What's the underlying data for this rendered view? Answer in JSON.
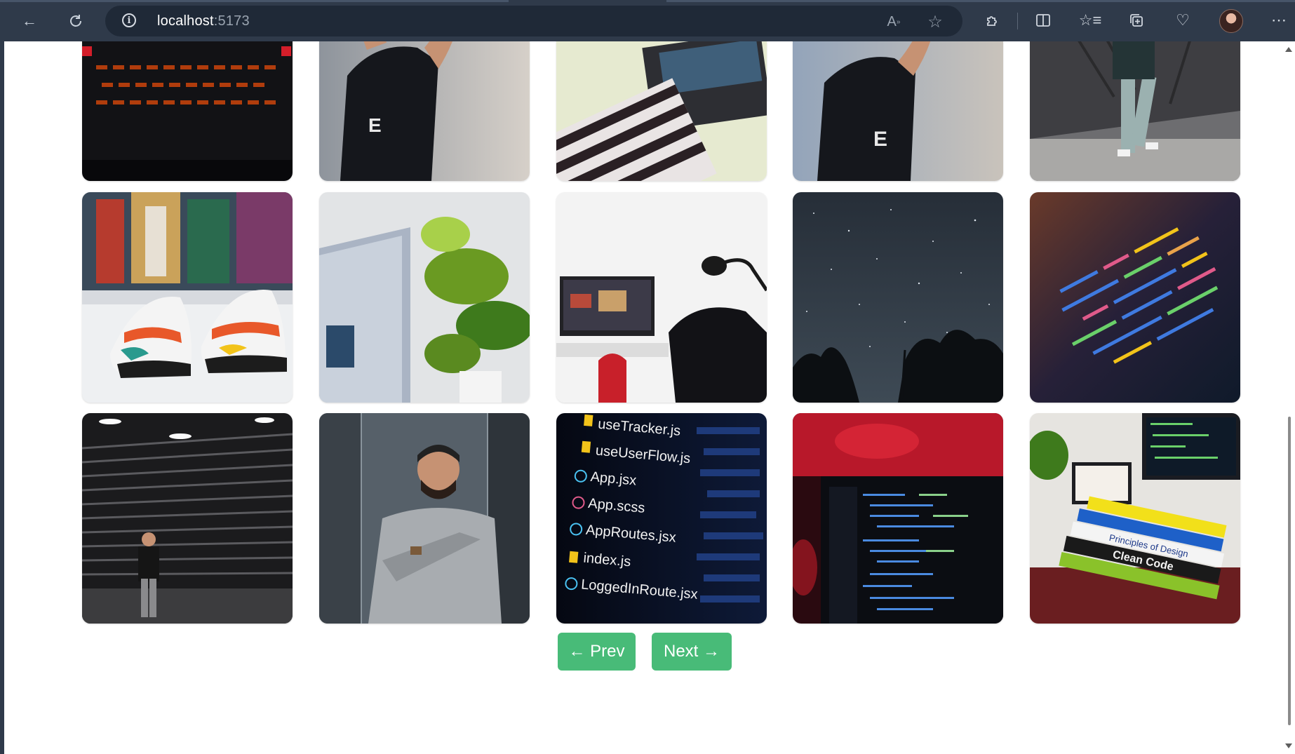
{
  "browser": {
    "url_host": "localhost",
    "url_port": ":5173",
    "icons": [
      "back-icon",
      "refresh-icon",
      "site-info-icon",
      "read-aloud-icon",
      "favorite-star-icon",
      "extensions-icon",
      "split-screen-icon",
      "favorites-icon",
      "collections-icon",
      "browser-essentials-icon",
      "profile-avatar",
      "more-icon"
    ]
  },
  "gallery": {
    "photos": [
      {
        "subject": "backlit keyboard",
        "colors": [
          "#0a0a0c",
          "#c24a10"
        ]
      },
      {
        "subject": "man in black t-shirt",
        "colors": [
          "#cfcac4",
          "#1a1c22"
        ]
      },
      {
        "subject": "person typing on laptop",
        "colors": [
          "#e7ead2",
          "#2a2a2e"
        ]
      },
      {
        "subject": "man in black t-shirt",
        "colors": [
          "#a6b4c6",
          "#1a1c22"
        ]
      },
      {
        "subject": "man walking street",
        "colors": [
          "#6e6e70",
          "#a9b7b7"
        ]
      },
      {
        "subject": "sneakers",
        "colors": [
          "#e6e8ea",
          "#e8582a"
        ]
      },
      {
        "subject": "monitor and plant",
        "colors": [
          "#c8ccd2",
          "#5e8a24"
        ]
      },
      {
        "subject": "desk setup with microphone",
        "colors": [
          "#f2f2f2",
          "#15151a"
        ]
      },
      {
        "subject": "night sky stars",
        "colors": [
          "#2c3540",
          "#0e1216"
        ]
      },
      {
        "subject": "code on screen",
        "colors": [
          "#3a2a3e",
          "#2560b8"
        ]
      },
      {
        "subject": "man at shutter wall",
        "colors": [
          "#2a2a2c",
          "#8a8a8c"
        ]
      },
      {
        "subject": "man in checked blazer",
        "colors": [
          "#4e5860",
          "#a8acb0"
        ]
      },
      {
        "subject": "file list in code editor",
        "colors": [
          "#060a14",
          "#f2c31a"
        ]
      },
      {
        "subject": "laptop code editor",
        "colors": [
          "#c21a28",
          "#0d0f14"
        ]
      },
      {
        "subject": "desk with books",
        "colors": [
          "#e8e6e2",
          "#2a60c8"
        ]
      }
    ],
    "tile_text": [
      "useTracker.js",
      "useUserFlow.js",
      "App.jsx",
      "App.scss",
      "AppRoutes.jsx",
      "index.js",
      "LoggedInRoute.jsx",
      "Clean Code",
      "Principles of Design"
    ]
  },
  "pagination": {
    "prev_label": "← Prev",
    "next_label": "Next →",
    "accent": "#48bb78"
  }
}
